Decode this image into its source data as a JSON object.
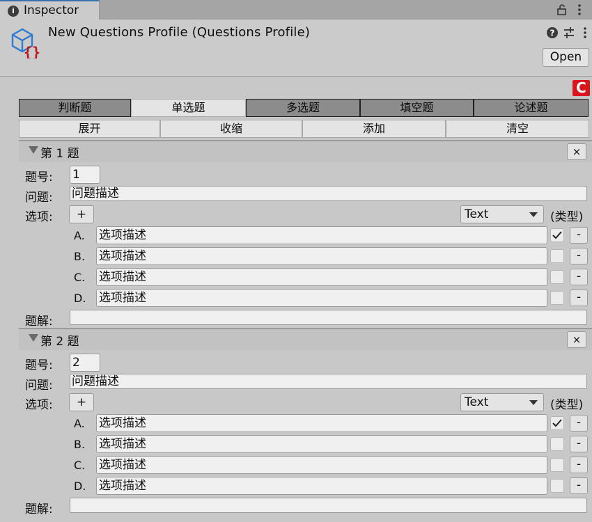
{
  "tab": {
    "label": "Inspector"
  },
  "header": {
    "title": "New Questions Profile (Questions Profile)",
    "open_label": "Open"
  },
  "logo_text": "C",
  "question_tabs": [
    {
      "label": "判断题",
      "active": false
    },
    {
      "label": "单选题",
      "active": true
    },
    {
      "label": "多选题",
      "active": false
    },
    {
      "label": "填空题",
      "active": false
    },
    {
      "label": "论述题",
      "active": false
    }
  ],
  "actions": [
    "展开",
    "收缩",
    "添加",
    "清空"
  ],
  "labels": {
    "number": "题号:",
    "question": "问题:",
    "options": "选项:",
    "explanation": "题解:",
    "type": "(类型)",
    "add": "+",
    "remove": "-",
    "close": "×"
  },
  "questions": [
    {
      "title": "第 1 题",
      "number": "1",
      "question_text": "问题描述",
      "type": "Text",
      "options": [
        {
          "letter": "A.",
          "text": "选项描述",
          "checked": true
        },
        {
          "letter": "B.",
          "text": "选项描述",
          "checked": false
        },
        {
          "letter": "C.",
          "text": "选项描述",
          "checked": false
        },
        {
          "letter": "D.",
          "text": "选项描述",
          "checked": false
        }
      ],
      "explanation": ""
    },
    {
      "title": "第 2 题",
      "number": "2",
      "question_text": "问题描述",
      "type": "Text",
      "options": [
        {
          "letter": "A.",
          "text": "选项描述",
          "checked": true
        },
        {
          "letter": "B.",
          "text": "选项描述",
          "checked": false
        },
        {
          "letter": "C.",
          "text": "选项描述",
          "checked": false
        },
        {
          "letter": "D.",
          "text": "选项描述",
          "checked": false
        }
      ],
      "explanation": ""
    }
  ]
}
